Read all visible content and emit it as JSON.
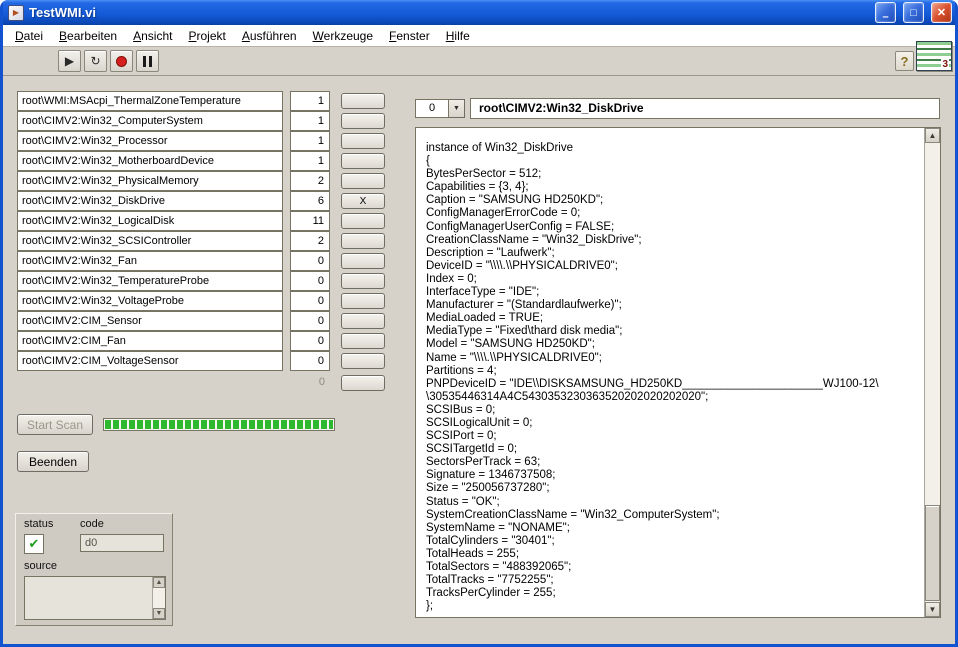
{
  "window": {
    "title": "TestWMI.vi",
    "controls": {
      "minimize": "–",
      "maximize": "□",
      "close": "✕"
    },
    "menu": [
      "Datei",
      "Bearbeiten",
      "Ansicht",
      "Projekt",
      "Ausführen",
      "Werkzeuge",
      "Fenster",
      "Hilfe"
    ]
  },
  "toolbar": {
    "run_icon": "▶",
    "run_continuous_icon": "↻",
    "help_label": "?",
    "vi_icon_badge": "3"
  },
  "icons": {
    "arrow_up": "▲",
    "arrow_down": "▼"
  },
  "wmi_list": {
    "selected_marker": "X",
    "footer_count": "0",
    "rows": [
      {
        "path": "root\\WMI:MSAcpi_ThermalZoneTemperature",
        "count": "1",
        "selected": false
      },
      {
        "path": "root\\CIMV2:Win32_ComputerSystem",
        "count": "1",
        "selected": false
      },
      {
        "path": "root\\CIMV2:Win32_Processor",
        "count": "1",
        "selected": false
      },
      {
        "path": "root\\CIMV2:Win32_MotherboardDevice",
        "count": "1",
        "selected": false
      },
      {
        "path": "root\\CIMV2:Win32_PhysicalMemory",
        "count": "2",
        "selected": false
      },
      {
        "path": "root\\CIMV2:Win32_DiskDrive",
        "count": "6",
        "selected": true
      },
      {
        "path": "root\\CIMV2:Win32_LogicalDisk",
        "count": "11",
        "selected": false
      },
      {
        "path": "root\\CIMV2:Win32_SCSIController",
        "count": "2",
        "selected": false
      },
      {
        "path": "root\\CIMV2:Win32_Fan",
        "count": "0",
        "selected": false
      },
      {
        "path": "root\\CIMV2:Win32_TemperatureProbe",
        "count": "0",
        "selected": false
      },
      {
        "path": "root\\CIMV2:Win32_VoltageProbe",
        "count": "0",
        "selected": false
      },
      {
        "path": "root\\CIMV2:CIM_Sensor",
        "count": "0",
        "selected": false
      },
      {
        "path": "root\\CIMV2:CIM_Fan",
        "count": "0",
        "selected": false
      },
      {
        "path": "root\\CIMV2:CIM_VoltageSensor",
        "count": "0",
        "selected": false
      }
    ]
  },
  "controls": {
    "start_scan_label": "Start Scan",
    "beenden_label": "Beenden"
  },
  "status_cluster": {
    "status_label": "status",
    "status_ok_glyph": "✔",
    "code_label": "code",
    "code_value": "d0",
    "source_label": "source"
  },
  "detail": {
    "index_value": "0",
    "class_path": "root\\CIMV2:Win32_DiskDrive",
    "instance_lines": [
      "instance of Win32_DiskDrive",
      "{",
      "BytesPerSector = 512;",
      "Capabilities = {3, 4};",
      "Caption = \"SAMSUNG HD250KD\";",
      "ConfigManagerErrorCode = 0;",
      "ConfigManagerUserConfig = FALSE;",
      "CreationClassName = \"Win32_DiskDrive\";",
      "Description = \"Laufwerk\";",
      "DeviceID = \"\\\\\\\\.\\\\PHYSICALDRIVE0\";",
      "Index = 0;",
      "InterfaceType = \"IDE\";",
      "Manufacturer = \"(Standardlaufwerke)\";",
      "MediaLoaded = TRUE;",
      "MediaType = \"Fixed\\thard disk media\";",
      "Model = \"SAMSUNG HD250KD\";",
      "Name = \"\\\\\\\\.\\\\PHYSICALDRIVE0\";",
      "Partitions = 4;",
      "PNPDeviceID = \"IDE\\\\DISKSAMSUNG_HD250KD______________________WJ100-12\\",
      "\\30535446314A4C5430353230363520202020202020\";",
      "SCSIBus = 0;",
      "SCSILogicalUnit = 0;",
      "SCSIPort = 0;",
      "SCSITargetId = 0;",
      "SectorsPerTrack = 63;",
      "Signature = 1346737508;",
      "Size = \"250056737280\";",
      "Status = \"OK\";",
      "SystemCreationClassName = \"Win32_ComputerSystem\";",
      "SystemName = \"NONAME\";",
      "TotalCylinders = \"30401\";",
      "TotalHeads = 255;",
      "TotalSectors = \"488392065\";",
      "TotalTracks = \"7752255\";",
      "TracksPerCylinder = 255;",
      "};"
    ]
  },
  "colors": {
    "titlebar_blue": "#1658d6",
    "close_red": "#d9502e",
    "progress_green": "#2db82d",
    "status_ok_green": "#1f9e1f",
    "panel_gray": "#d6d2ca"
  }
}
